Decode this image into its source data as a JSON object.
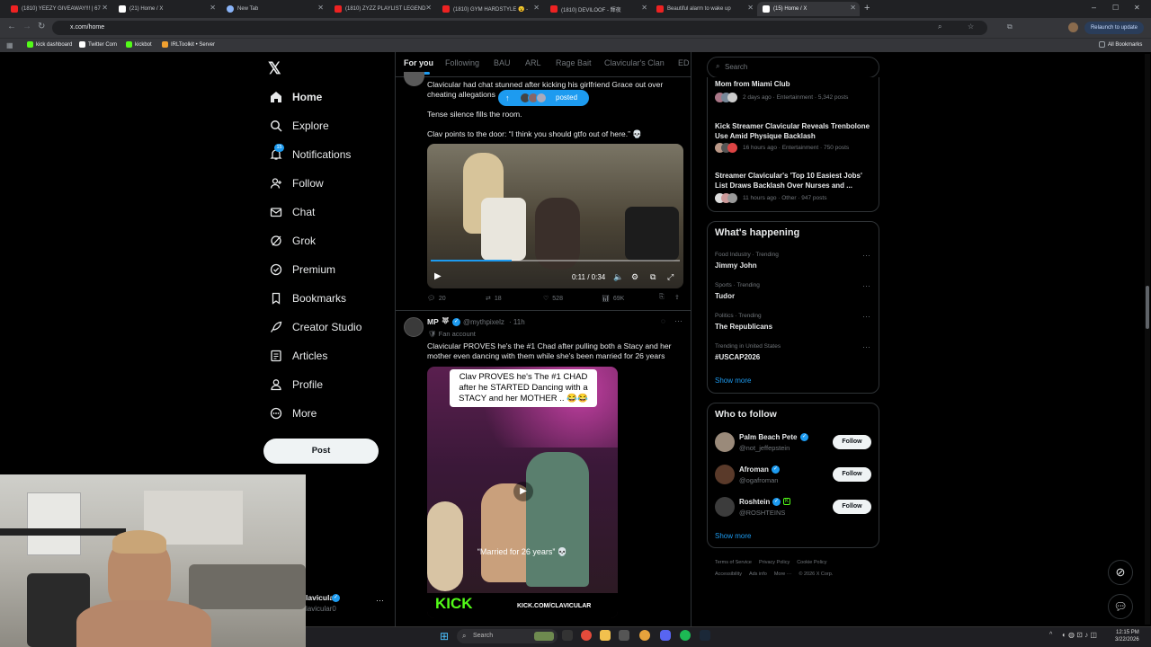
{
  "browser": {
    "tabs": [
      {
        "label": "(1810) YEEZY GIVEAWAY!!! | 67"
      },
      {
        "label": "(21) Home / X"
      },
      {
        "label": "New Tab"
      },
      {
        "label": "(1810) ZYZZ PLAYLIST LEGEND"
      },
      {
        "label": "(1810) GYM HARDSTYLE 😮 -"
      },
      {
        "label": "(1810) DEVILOOF - 輝夜"
      },
      {
        "label": "Beautiful alarm to wake up"
      },
      {
        "label": "(15) Home / X"
      }
    ],
    "url": "x.com/home",
    "relaunch": "Relaunch to update",
    "bookmarks": [
      "kick dashboard",
      "Twitter Com",
      "kickbot",
      "IRLToolkit • Server"
    ],
    "all_bookmarks": "All Bookmarks"
  },
  "sidebar": {
    "items": [
      {
        "label": "Home"
      },
      {
        "label": "Explore"
      },
      {
        "label": "Notifications",
        "badge": "15"
      },
      {
        "label": "Follow"
      },
      {
        "label": "Chat"
      },
      {
        "label": "Grok"
      },
      {
        "label": "Premium"
      },
      {
        "label": "Bookmarks"
      },
      {
        "label": "Creator Studio"
      },
      {
        "label": "Articles"
      },
      {
        "label": "Profile"
      },
      {
        "label": "More"
      }
    ],
    "post_label": "Post",
    "account_name": "lavicular",
    "account_handle": "lavicular0",
    "account_more": "···"
  },
  "timeline": {
    "tabs": [
      "For you",
      "Following",
      "BAU",
      "ARL",
      "Rage Bait",
      "Clavicular's Clan",
      "ED"
    ],
    "posted_pill": "posted",
    "tweet1": {
      "text1": "Clavicular had chat stunned after kicking his girlfriend Grace out over cheating allegations",
      "text2": "Tense silence fills the room.",
      "text3": "Clav points to the door: “I think you should gtfo out of here.” 💀",
      "video_time": "0:11 / 0:34",
      "replies": "20",
      "retweets": "18",
      "likes": "528",
      "views": "69K"
    },
    "tweet2": {
      "name": "MP",
      "handle": "@mythpixelz",
      "time": "· 11h",
      "label": "Fan account",
      "text": "Clavicular PROVES he's the #1 Chad after pulling both a Stacy and her mother even dancing with them while she's been married for 26 years",
      "caption_line1": "Clav PROVES he's The #1 CHAD",
      "caption_line2": "after he STARTED Dancing with a",
      "caption_line3": "STACY and her MOTHER .. 😂😂",
      "subtitle": "“Married for 26 years” 💀",
      "kick_logo": "KICK",
      "kick_url": "KICK.COM/CLAVICULAR"
    }
  },
  "right": {
    "search_placeholder": "Search",
    "news": [
      {
        "title": "Mom from Miami Club",
        "meta": "2 days ago · Entertainment · 5,342 posts"
      },
      {
        "title": "Kick Streamer Clavicular Reveals Trenbolone Use Amid Physique Backlash",
        "meta": "16 hours ago · Entertainment · 750 posts"
      },
      {
        "title": "Streamer Clavicular's 'Top 10 Easiest Jobs' List Draws Backlash Over Nurses and ...",
        "meta": "11 hours ago · Other · 947 posts"
      }
    ],
    "happening_title": "What's happening",
    "trends": [
      {
        "meta": "Food Industry · Trending",
        "title": "Jimmy John"
      },
      {
        "meta": "Sports · Trending",
        "title": "Tudor"
      },
      {
        "meta": "Politics · Trending",
        "title": "The Republicans"
      },
      {
        "meta": "Trending in United States",
        "title": "#USCAP2026"
      }
    ],
    "show_more": "Show more",
    "wtf_title": "Who to follow",
    "follow": [
      {
        "name": "Palm Beach Pete",
        "handle": "@not_jeffepstein"
      },
      {
        "name": "Afroman",
        "handle": "@ogafroman"
      },
      {
        "name": "Roshtein",
        "handle": "@ROSHTEINS"
      }
    ],
    "follow_label": "Follow",
    "show_more2": "Show more",
    "footer1": [
      "Terms of Service",
      "Privacy Policy",
      "Cookie Policy"
    ],
    "footer2": [
      "Accessibility",
      "Ads info",
      "More ···",
      "© 2026 X Corp."
    ]
  },
  "taskbar": {
    "search": "Search",
    "time": "12:15 PM",
    "date": "3/22/2026"
  }
}
